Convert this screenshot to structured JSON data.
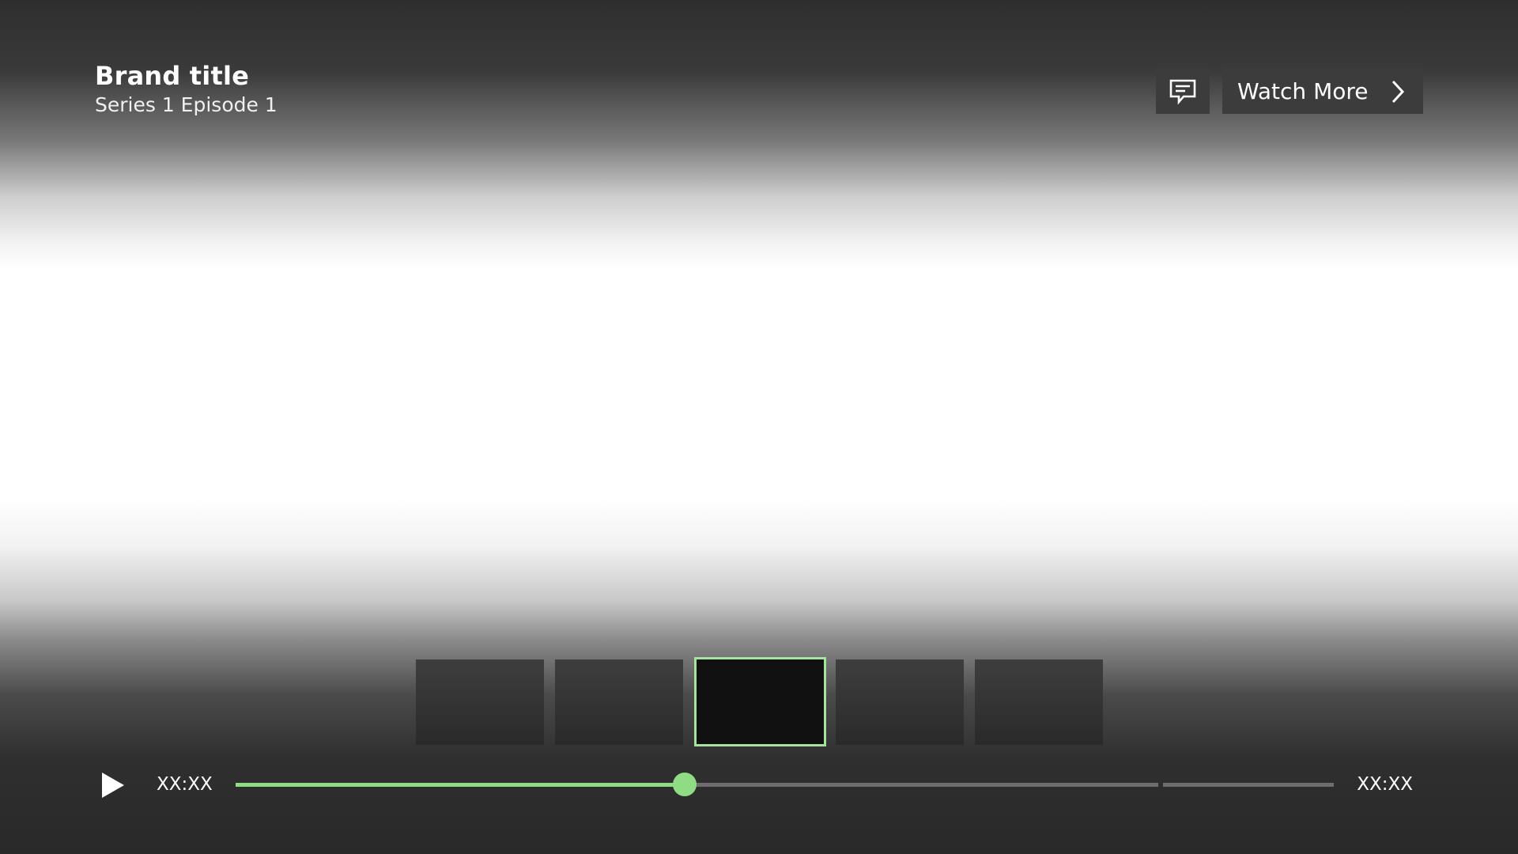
{
  "header": {
    "brand_title": "Brand title",
    "episode_title": "Series 1 Episode 1"
  },
  "actions": {
    "subtitles_icon": "speech-bubble-icon",
    "watch_more_label": "Watch More",
    "watch_more_icon": "chevron-right-icon"
  },
  "thumbnails": {
    "count": 5,
    "selected_index": 2
  },
  "player": {
    "play_icon": "play-icon",
    "current_time": "XX:XX",
    "total_time": "XX:XX",
    "progress_fraction": 0.487
  },
  "colors": {
    "accent": "#8fdc85",
    "selected_border": "#a6e3a0",
    "button_bg": "#3c3c3c"
  }
}
